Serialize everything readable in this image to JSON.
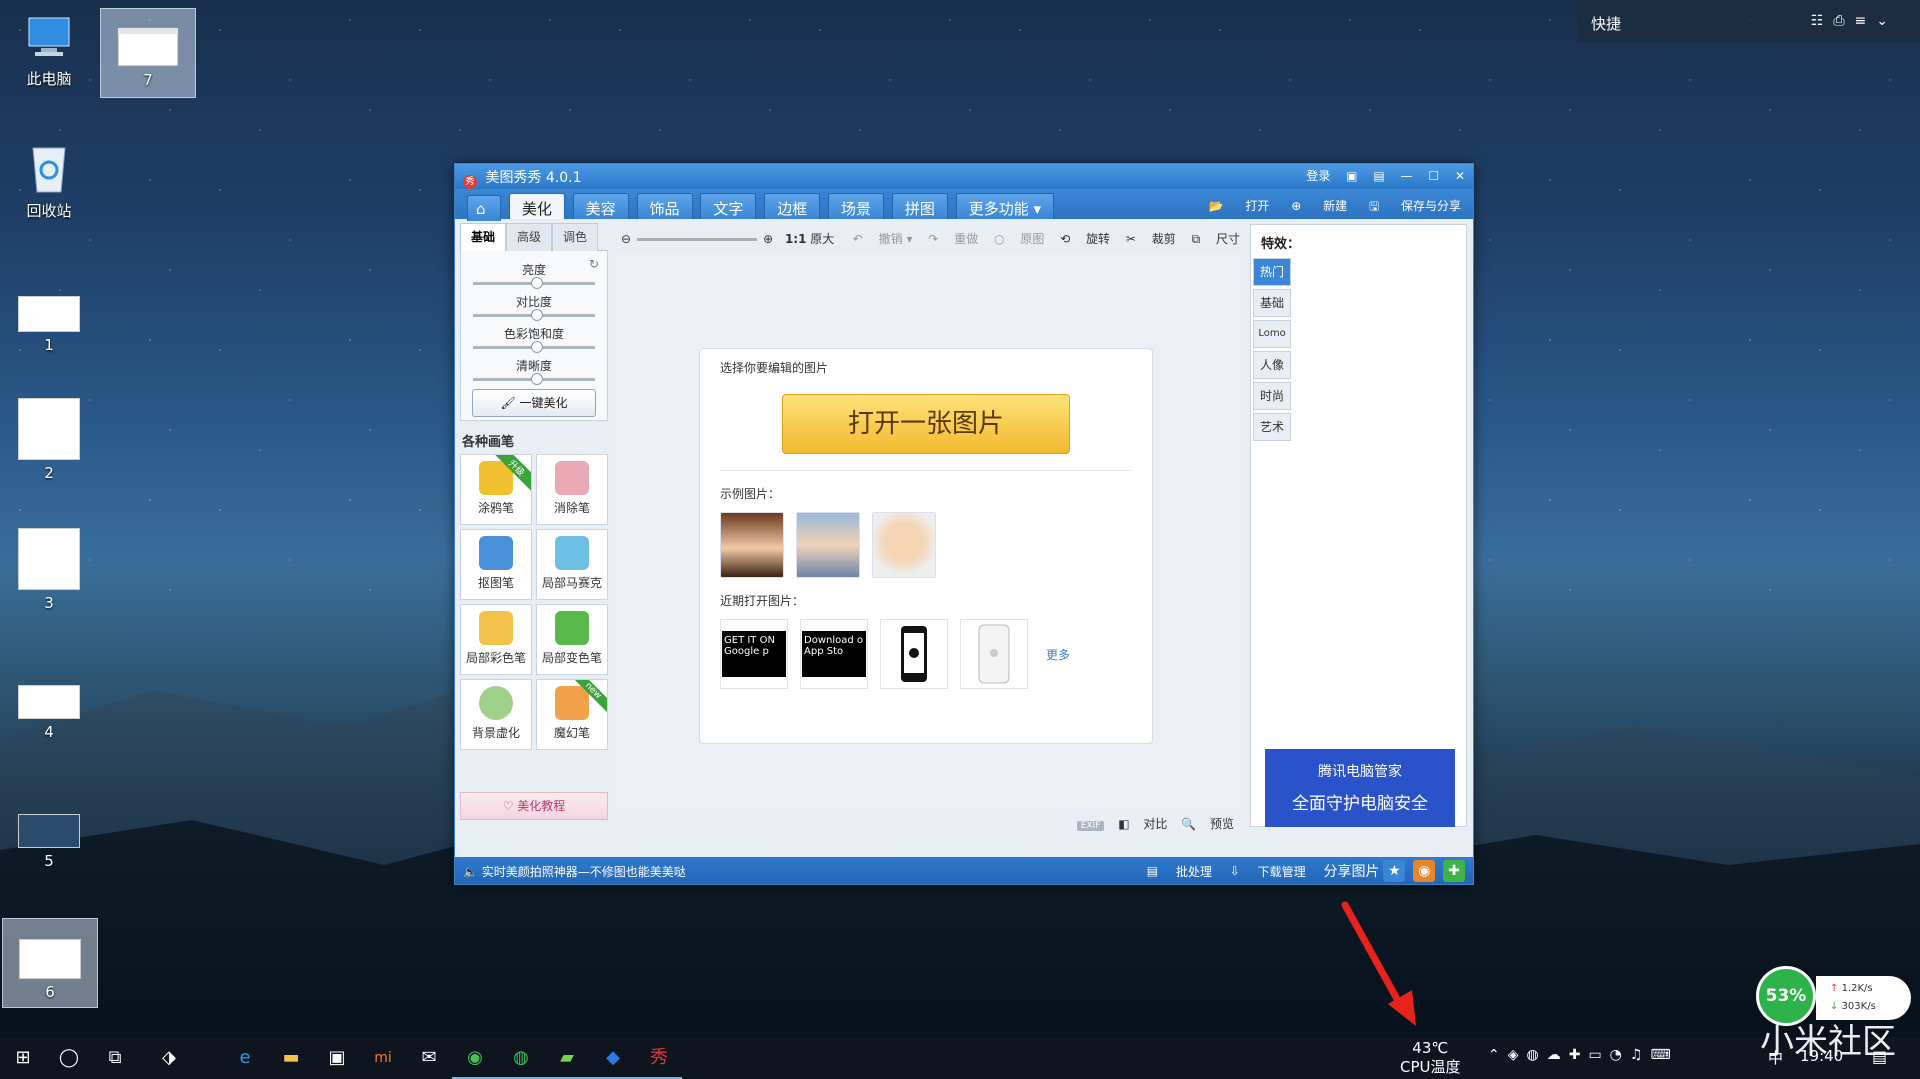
{
  "desktop": {
    "icons": [
      {
        "label": "此电脑"
      },
      {
        "label": "7"
      },
      {
        "label": "回收站"
      },
      {
        "label": "1"
      },
      {
        "label": "2"
      },
      {
        "label": "3"
      },
      {
        "label": "4"
      },
      {
        "label": "5"
      },
      {
        "label": "6"
      }
    ]
  },
  "quick_panel": {
    "title": "快捷"
  },
  "window": {
    "title": "美图秀秀 4.0.1",
    "login": "登录",
    "tabs": [
      "美化",
      "美容",
      "饰品",
      "文字",
      "边框",
      "场景",
      "拼图",
      "更多功能"
    ],
    "menu_right": {
      "open": "打开",
      "new": "新建",
      "save": "保存与分享"
    },
    "subtabs": [
      "基础",
      "高级",
      "调色"
    ],
    "sliders": [
      "亮度",
      "对比度",
      "色彩饱和度",
      "清晰度"
    ],
    "onekey": "一键美化",
    "brush_title": "各种画笔",
    "brushes": [
      {
        "label": "涂鸦笔",
        "badge": "升级"
      },
      {
        "label": "消除笔"
      },
      {
        "label": "抠图笔"
      },
      {
        "label": "局部马赛克"
      },
      {
        "label": "局部彩色笔"
      },
      {
        "label": "局部变色笔"
      },
      {
        "label": "背景虚化"
      },
      {
        "label": "魔幻笔",
        "badge": "new"
      }
    ],
    "tutorial": "美化教程",
    "toolbar": {
      "ratio": "1:1",
      "original": "原大",
      "undo": "撤销",
      "redo": "重做",
      "original_img": "原图",
      "rotate": "旋转",
      "crop": "裁剪",
      "size": "尺寸"
    },
    "card": {
      "choose": "选择你要编辑的图片",
      "open_button": "打开一张图片",
      "samples": "示例图片：",
      "recent": "近期打开图片：",
      "recent_items": [
        "GET IT ON Google p",
        "Download o App Sto"
      ],
      "more": "更多"
    },
    "bottom": {
      "exif": "EXIF",
      "compare": "对比",
      "preview": "预览"
    },
    "effects": {
      "title": "特效：",
      "tabs": [
        "热门",
        "基础",
        "Lomo",
        "人像",
        "时尚",
        "艺术"
      ]
    },
    "ad": {
      "line1": "腾讯电脑管家",
      "line2": "全面守护电脑安全"
    },
    "status": {
      "message": "实时美颜拍照神器—不修图也能美美哒",
      "batch": "批处理",
      "download": "下载管理",
      "share": "分享图片"
    }
  },
  "monitor": {
    "percent": "53%",
    "up": "1.2K/s",
    "down": "303K/s"
  },
  "taskbar": {
    "cpu_temp": "43℃",
    "cpu_label": "CPU温度",
    "ime": "中",
    "time": "19:40"
  },
  "watermark": "小米社区",
  "colors": {
    "accent": "#2d74c0",
    "open_button": "#f3b92e",
    "ad": "#2a52c9",
    "monitor": "#2db34a",
    "arrow": "#e8221c"
  }
}
